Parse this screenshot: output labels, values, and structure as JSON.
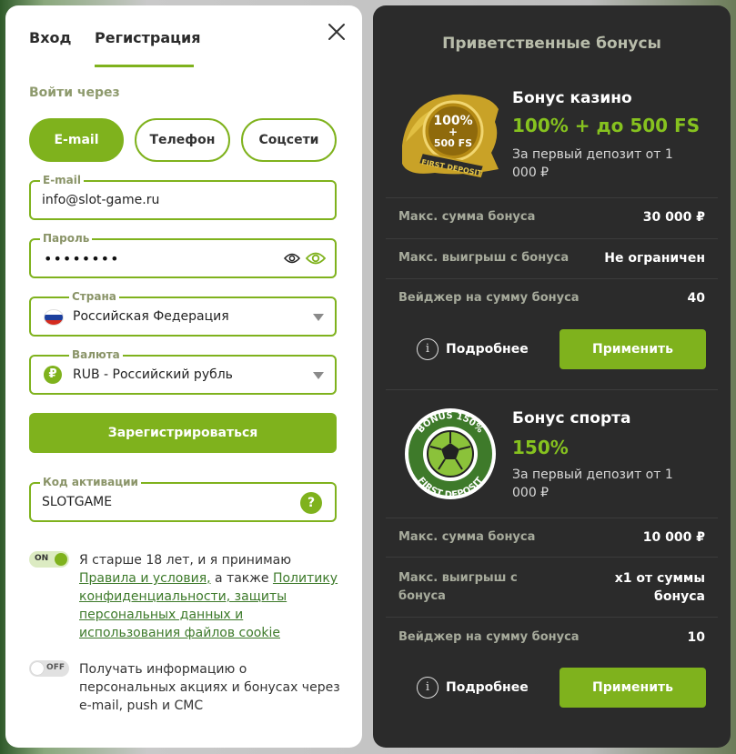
{
  "tabs": {
    "login": "Вход",
    "register": "Регистрация"
  },
  "auth": {
    "via_label": "Войти через",
    "methods": {
      "email": "E-mail",
      "phone": "Телефон",
      "social": "Соцсети"
    }
  },
  "form": {
    "email": {
      "label": "E-mail",
      "value": "info@slot-game.ru"
    },
    "password": {
      "label": "Пароль",
      "masked": "••••••••"
    },
    "country": {
      "label": "Страна",
      "value": "Российская Федерация"
    },
    "currency": {
      "label": "Валюта",
      "symbol": "₽",
      "value": "RUB - Российский рубль"
    },
    "register_button": "Зарегистрироваться",
    "activation_code": {
      "label": "Код активации",
      "value": "SLOTGAME"
    },
    "help_icon": "?"
  },
  "consent": {
    "toggle_on_label": "ON",
    "text_start": "Я старше 18 лет, и я принимаю ",
    "rules_link": "Правила и условия,",
    "text_mid": " а также ",
    "privacy_link": "Политику конфиденциальности, защиты персональных данных и использования файлов cookie"
  },
  "promo": {
    "toggle_off_label": "OFF",
    "text": "Получать информацию о персональных акциях и бонусах через e-mail, push и СМС"
  },
  "bonuses": {
    "title": "Приветственные бонусы",
    "casino": {
      "badge_line1": "100%",
      "badge_line2": "+",
      "badge_line3": "500 FS",
      "badge_ribbon": "FIRST DEPOSIT",
      "name": "Бонус казино",
      "amount": "100% + до 500 FS",
      "desc": "За первый депозит от 1 000 ₽",
      "rows": [
        {
          "label": "Макс. сумма бонуса",
          "value": "30 000 ₽"
        },
        {
          "label": "Макс. выигрыш с бонуса",
          "value": "Не ограничен"
        },
        {
          "label": "Вейджер на сумму бонуса",
          "value": "40"
        }
      ],
      "more": "Подробнее",
      "apply": "Применить"
    },
    "sport": {
      "badge_top": "BONUS 150%",
      "badge_bottom": "FIRST DEPOSIT",
      "name": "Бонус спорта",
      "amount": "150%",
      "desc": "За первый депозит от 1 000 ₽",
      "rows": [
        {
          "label": "Макс. сумма бонуса",
          "value": "10 000 ₽"
        },
        {
          "label": "Макс. выигрыш с бонуса",
          "value": "x1 от суммы бонуса"
        },
        {
          "label": "Вейджер на сумму бонуса",
          "value": "10"
        }
      ],
      "more": "Подробнее",
      "apply": "Применить"
    }
  },
  "colors": {
    "accent": "#7fb21d",
    "panel_dark": "#2b2b2b",
    "bonus_green": "#86c21f"
  }
}
